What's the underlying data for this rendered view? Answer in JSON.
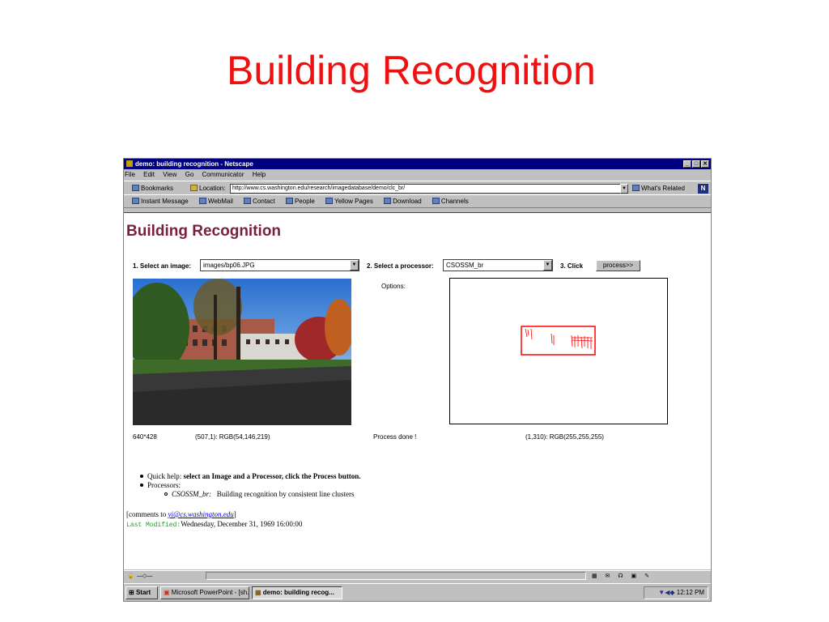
{
  "slide": {
    "title": "Building Recognition"
  },
  "browser": {
    "title": "demo: building recognition - Netscape",
    "window_buttons": {
      "minimize": "_",
      "maximize": "□",
      "close": "✕"
    },
    "menu": [
      "File",
      "Edit",
      "View",
      "Go",
      "Communicator",
      "Help"
    ],
    "nav": {
      "bookmarks_label": "Bookmarks",
      "location_label": "Location:",
      "location_value": "http://www.cs.washington.edu/research/imagedatabase/demo/clc_br/",
      "whats_related": "What's Related",
      "netscape_logo": "N"
    },
    "personal_bar": [
      "Instant Message",
      "WebMail",
      "Contact",
      "People",
      "Yellow Pages",
      "Download",
      "Channels"
    ]
  },
  "page": {
    "heading": "Building Recognition",
    "step1_label": "1. Select an image:",
    "image_select_value": "images/bp06.JPG",
    "step2_label": "2. Select a processor:",
    "processor_select_value": "CSOSSM_br",
    "step3_label": "3. Click",
    "process_button": "process>>",
    "options_label": "Options:",
    "image_size": "640*428",
    "left_pixel_info": "(507,1): RGB(54,146,219)",
    "process_status": "Process done !",
    "right_pixel_info": "(1,310): RGB(255,255,255)",
    "help": {
      "quick_help_label": "Quick help: ",
      "quick_help_text": "select an Image and a Processor, click the Process button.",
      "processors_label": "Processors:",
      "processor_name": "CSOSSM_br:",
      "processor_desc": "Building recognition by consistent line clusters"
    },
    "comments_prefix": "[comments to ",
    "comments_email": "yi@cs.washington.edu",
    "comments_suffix": "]",
    "last_modified_label": "Last Modified:",
    "last_modified_value": "Wednesday, December 31, 1969 16:00:00"
  },
  "taskbar": {
    "start": "Start",
    "items": [
      "Microsoft PowerPoint - [sh...",
      "demo: building recog..."
    ],
    "clock": "12:12 PM"
  },
  "colors": {
    "slide_title": "#ee1111",
    "page_heading": "#7a1f3e",
    "titlebar": "#000080",
    "detection_box": "#ff0000",
    "last_modified_label": "#20a020"
  }
}
